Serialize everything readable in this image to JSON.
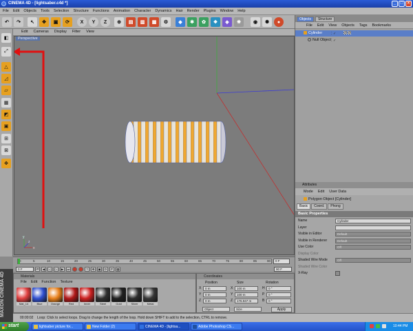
{
  "window": {
    "title": "CINEMA 4D - [lightsaber.c4d *]",
    "min_icon": "minimize-icon",
    "max_icon": "maximize-icon",
    "close_icon": "close-icon"
  },
  "menu": [
    "File",
    "Edit",
    "Objects",
    "Tools",
    "Selection",
    "Structure",
    "Functions",
    "Animation",
    "Character",
    "Dynamics",
    "Hair",
    "Render",
    "Plugins",
    "Window",
    "Help"
  ],
  "toolbar_axes": [
    "X",
    "Y",
    "Z"
  ],
  "viewport": {
    "menu": [
      "Edit",
      "Cameras",
      "Display",
      "Filter",
      "View"
    ],
    "label": "Perspective",
    "axis_x": "x",
    "axis_y": "y",
    "axis_z": "z"
  },
  "timeline": {
    "ticks": [
      "0",
      "5",
      "10",
      "15",
      "20",
      "25",
      "30",
      "35",
      "40",
      "45",
      "50",
      "55",
      "60",
      "65",
      "70",
      "75",
      "80",
      "85",
      "90"
    ],
    "current_frame": "0 F",
    "start_field": "0 F",
    "end_field": "90 F",
    "end_frame": "0 F"
  },
  "materials": {
    "title": "Materials",
    "menu": [
      "File",
      "Edit",
      "Function",
      "Texture"
    ],
    "items": [
      {
        "name": "Mat_14",
        "color": "#e04040"
      },
      {
        "name": "Blue",
        "color": "#3050d0"
      },
      {
        "name": "Orange",
        "color": "#e8801a"
      },
      {
        "name": "Red",
        "color": "#b01818"
      },
      {
        "name": "Inner",
        "color": "#cc2020"
      },
      {
        "name": "Steel",
        "color": "#303030"
      },
      {
        "name": "Gold",
        "color": "#202020"
      },
      {
        "name": "Silver",
        "color": "#2c2c2c"
      },
      {
        "name": "Metal",
        "color": "#363636"
      }
    ]
  },
  "coordinates": {
    "title": "Coordinates",
    "headers": [
      "Position",
      "Size",
      "Rotation"
    ],
    "rows": [
      {
        "axis": "X",
        "pos": "0 m",
        "size_axis": "X",
        "size": "100 m",
        "rot_axis": "H",
        "rot": "0 °"
      },
      {
        "axis": "Y",
        "pos": "0 m",
        "size_axis": "Y",
        "size": "100 m",
        "rot_axis": "P",
        "rot": "0 °"
      },
      {
        "axis": "Z",
        "pos": "0 m",
        "size_axis": "Z",
        "size": "176.947 m",
        "rot_axis": "B",
        "rot": "0 °"
      }
    ],
    "mode_left": "Object",
    "mode_mid": "Size",
    "apply_label": "Apply"
  },
  "objects_panel": {
    "tabs": [
      "Objects",
      "Structure"
    ],
    "menu": [
      "File",
      "Edit",
      "View",
      "Objects",
      "Tags",
      "Bookmarks"
    ],
    "items": [
      {
        "name": "Cylinder",
        "selected": true
      },
      {
        "name": "Null Object",
        "selected": false
      }
    ]
  },
  "attributes": {
    "title": "Attributes",
    "menu": [
      "Mode",
      "Edit",
      "User Data"
    ],
    "object_line": "Polygon Object [Cylinder]",
    "tabs": [
      "Basic",
      "Coord.",
      "Phong"
    ],
    "section": "Basic Properties",
    "props": [
      {
        "label": "Name",
        "value": "Cylinder",
        "kind": "text"
      },
      {
        "label": "Layer",
        "value": "",
        "kind": "text"
      },
      {
        "label": "Visible in Editor",
        "value": "Default",
        "kind": "select"
      },
      {
        "label": "Visible in Renderer",
        "value": "Default",
        "kind": "select"
      },
      {
        "label": "Use Color",
        "value": "Off",
        "kind": "select"
      },
      {
        "label": "Display Color",
        "value": "",
        "kind": "dim"
      },
      {
        "label": "Shaded Wire Mode",
        "value": "Off",
        "kind": "select"
      },
      {
        "label": "Shaded Wire Color",
        "value": "",
        "kind": "dim"
      },
      {
        "label": "X-Ray",
        "value": "",
        "kind": "check"
      }
    ]
  },
  "status": {
    "time": "00:00:02",
    "text": "Loop: Click to select loops. Drag to change the length of the loop. Hold down SHIFT to add to the selection, CTRL to remove."
  },
  "maxon_logo": "MAXON CINEMA 4D",
  "taskbar": {
    "start_label": "start",
    "tasks": [
      {
        "label": "lightsaber picture for...",
        "color": "#e8c040"
      },
      {
        "label": "New Folder (2)",
        "color": "#e8c040"
      },
      {
        "label": "CINEMA 4D - [lightsa...",
        "color": "#3070e0"
      },
      {
        "label": "Adobe Photoshop CS...",
        "color": "#2050a0"
      }
    ],
    "clock": "10:44 PM"
  }
}
